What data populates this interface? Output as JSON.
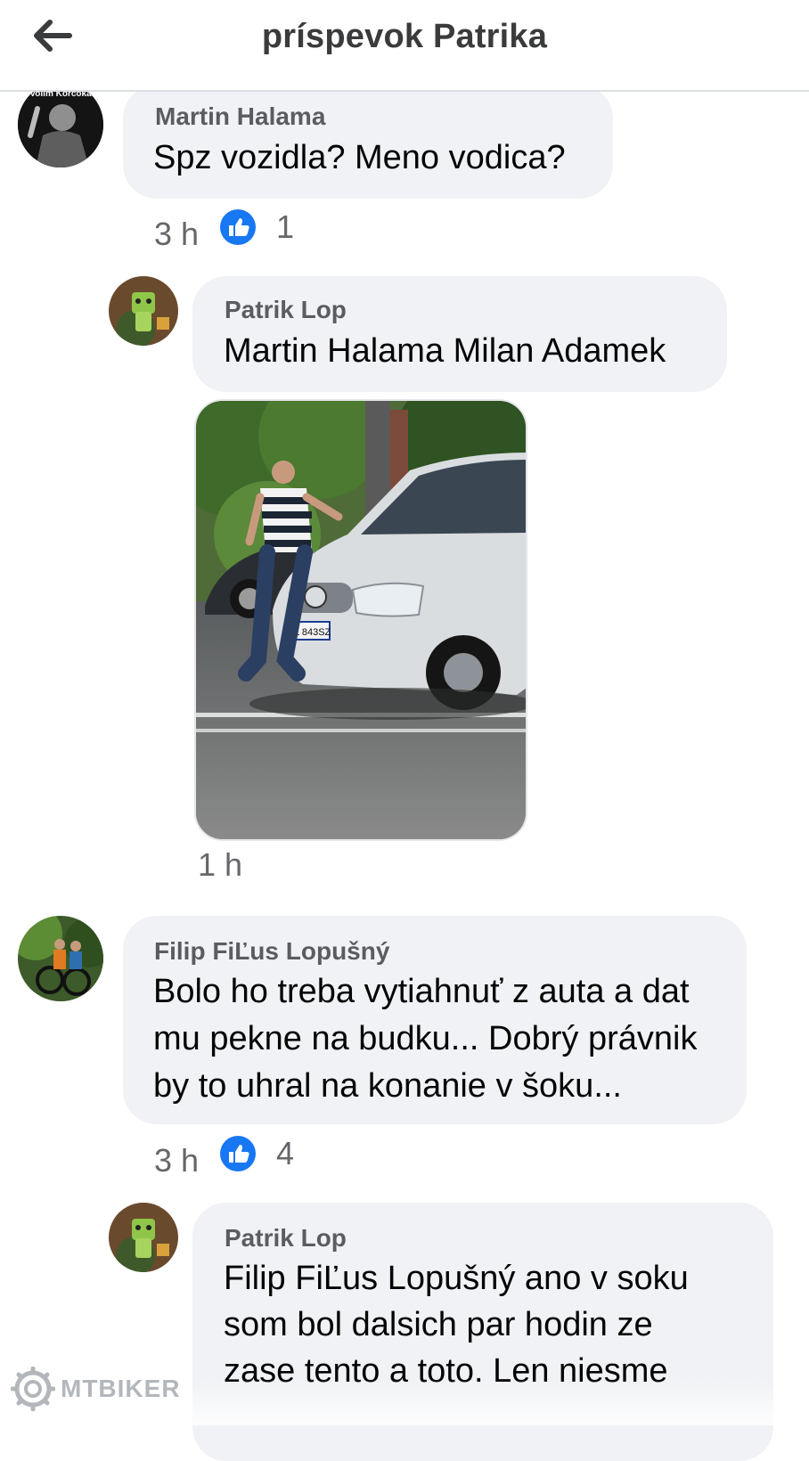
{
  "header": {
    "title": "príspevok Patrika"
  },
  "comments": [
    {
      "author": "Martin Halama",
      "text": "Spz vozidla? Meno vodica?",
      "time": "3 h",
      "likes": "1",
      "avatar_label": "Volim Korcoka"
    },
    {
      "author": "Patrik Lop",
      "text": "Martin Halama Milan Adamek",
      "time": "1 h",
      "plate": "BL 843SZ"
    },
    {
      "author": "Filip FiĽus Lopušný",
      "lines": [
        "Bolo ho treba vytiahnuť z auta a dat",
        "mu pekne na budku... Dobrý právnik",
        "by to uhral na konanie v šoku..."
      ],
      "time": "3 h",
      "likes": "4"
    },
    {
      "author": "Patrik Lop",
      "lines": [
        "Filip FiĽus Lopušný ano v soku",
        "som bol dalsich par hodin ze",
        "zase tento a toto. Len niesme"
      ]
    }
  ],
  "watermark": {
    "text": "MTBIKER"
  },
  "colors": {
    "like_blue": "#1877f2",
    "bubble": "#f0f2f5",
    "meta": "#65676b"
  }
}
